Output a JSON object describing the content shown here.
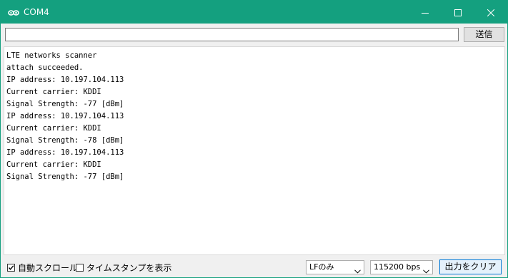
{
  "window": {
    "title": "COM4",
    "accent_color": "#14a07f",
    "icons": {
      "app": "arduino-icon",
      "minimize": "minimize-icon",
      "maximize": "maximize-icon",
      "close": "close-icon"
    }
  },
  "send_row": {
    "input_value": "",
    "send_label": "送信"
  },
  "output": {
    "lines": [
      "LTE networks scanner",
      "attach succeeded.",
      "IP address: 10.197.104.113",
      "Current carrier: KDDI",
      "Signal Strength: -77 [dBm]",
      "IP address: 10.197.104.113",
      "Current carrier: KDDI",
      "Signal Strength: -78 [dBm]",
      "IP address: 10.197.104.113",
      "Current carrier: KDDI",
      "Signal Strength: -77 [dBm]"
    ]
  },
  "bottom_bar": {
    "autoscroll_label": "自動スクロール",
    "autoscroll_checked": true,
    "timestamp_label": "タイムスタンプを表示",
    "timestamp_checked": false,
    "line_ending_value": "LFのみ",
    "baud_value": "115200 bps",
    "clear_label": "出力をクリア"
  }
}
